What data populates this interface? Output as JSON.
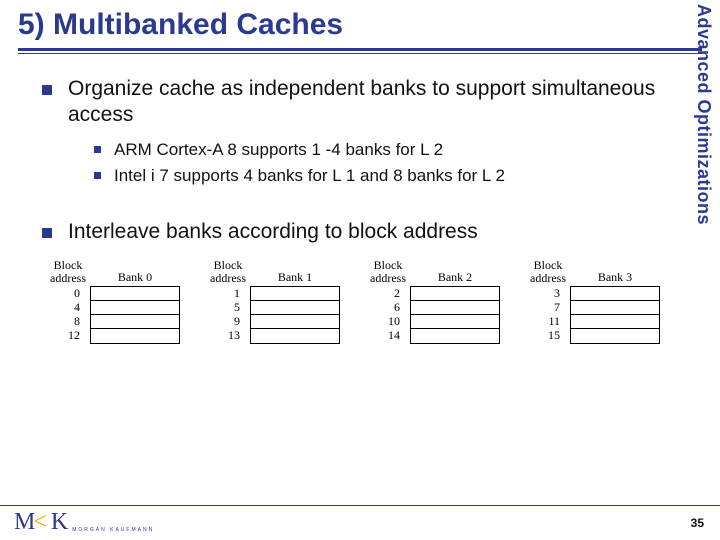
{
  "title": "5) Multibanked Caches",
  "sideLabel": "Advanced Optimizations",
  "bullets": {
    "b1": "Organize cache as independent banks to support simultaneous access",
    "b1s1": "ARM Cortex-A 8 supports 1 -4 banks for L 2",
    "b1s2": "Intel i 7 supports 4 banks for L 1 and 8 banks for L 2",
    "b2": "Interleave banks according to block address"
  },
  "diagram": {
    "addrHead1": "Block",
    "addrHead2": "address",
    "banks": [
      {
        "label": "Bank 0",
        "addrs": [
          "0",
          "4",
          "8",
          "12"
        ]
      },
      {
        "label": "Bank 1",
        "addrs": [
          "1",
          "5",
          "9",
          "13"
        ]
      },
      {
        "label": "Bank 2",
        "addrs": [
          "2",
          "6",
          "10",
          "14"
        ]
      },
      {
        "label": "Bank 3",
        "addrs": [
          "3",
          "7",
          "11",
          "15"
        ]
      }
    ]
  },
  "logo": {
    "mk": "M",
    "k": "K",
    "sub": "MORGAN KAUFMANN"
  },
  "pageNum": "35"
}
